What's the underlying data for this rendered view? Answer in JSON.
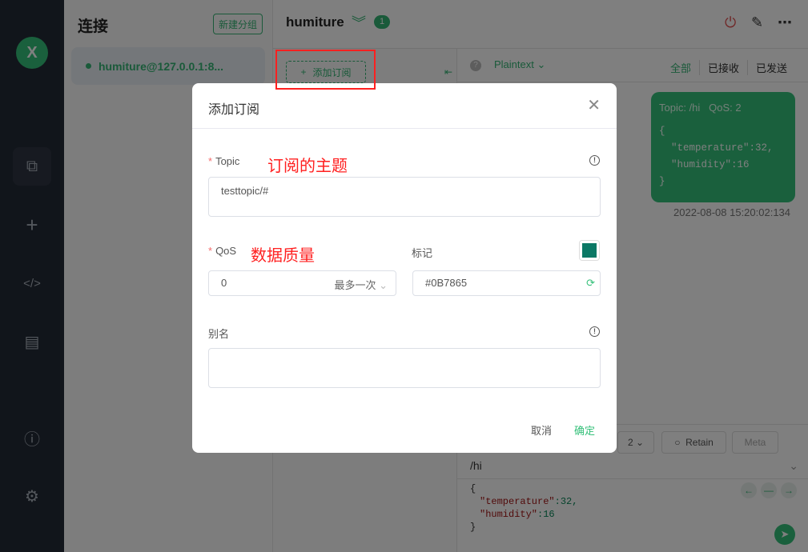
{
  "sidebar": {
    "logo": "X",
    "items": [
      "connections-icon",
      "plus-icon",
      "code-icon",
      "log-icon",
      "info-icon",
      "gear-icon"
    ]
  },
  "connections": {
    "title": "连接",
    "new_group": "新建分组",
    "items": [
      {
        "name": "humiture@127.0.0.1:8..."
      }
    ]
  },
  "header": {
    "title": "humiture",
    "badge": "1"
  },
  "subscriptions": {
    "add_label": "添加订阅"
  },
  "messages": {
    "format": "Plaintext",
    "filters": [
      "全部",
      "已接收",
      "已发送"
    ],
    "items": [
      {
        "topic": "Topic: /hi",
        "qos": "QoS: 2",
        "payload": "{\n  \"temperature\":32,\n  \"humidity\":16\n}",
        "time": "2022-08-08 15:20:02:134"
      }
    ]
  },
  "publish": {
    "qos": "2",
    "retain": "Retain",
    "meta": "Meta",
    "topic": "/hi",
    "payload_lines": [
      "{",
      "\"temperature\"",
      ":32,",
      "\"humidity\"",
      ":16",
      "}"
    ]
  },
  "dialog": {
    "title": "添加订阅",
    "topic_label": "Topic",
    "topic_annotation": "订阅的主题",
    "topic_value": "testtopic/#",
    "qos_label": "QoS",
    "qos_annotation": "数据质量",
    "qos_value": "0",
    "qos_desc": "最多一次",
    "mark_label": "标记",
    "color_value": "#0B7865",
    "alias_label": "别名",
    "alias_value": "",
    "cancel": "取消",
    "confirm": "确定"
  },
  "colors": {
    "accent": "#35c07a",
    "mark": "#0B7865",
    "annotation": "#ff2020"
  }
}
